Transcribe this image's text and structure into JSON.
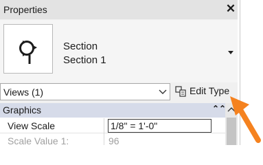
{
  "palette": {
    "title": "Properties",
    "close_symbol": "✕"
  },
  "type_selector": {
    "family": "Section",
    "type_name": "Section 1",
    "preview_icon": "section-head-icon"
  },
  "filter": {
    "value": "Views (1)",
    "edit_type_label": "Edit Type"
  },
  "properties": {
    "group_title": "Graphics",
    "collapse_symbol": "⌃⌃",
    "rows": [
      {
        "label": "View Scale",
        "value": "1/8\" = 1'-0\""
      },
      {
        "label": "Scale Value    1:",
        "value": "96"
      }
    ]
  },
  "colors": {
    "group_header": "#d6dbe9",
    "callout_arrow": "#f5821f"
  }
}
